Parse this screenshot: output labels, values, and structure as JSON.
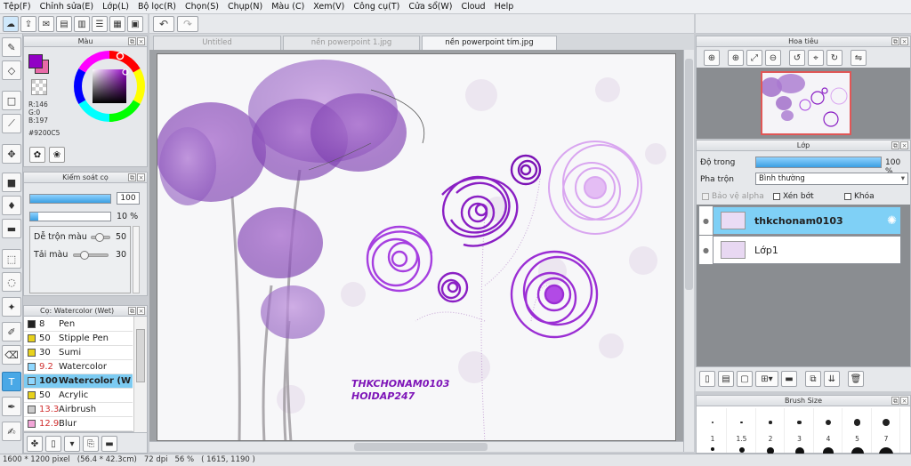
{
  "menu": [
    "Tệp(F)",
    "Chỉnh sửa(E)",
    "Lớp(L)",
    "Bộ lọc(R)",
    "Chọn(S)",
    "Chụp(N)",
    "Màu (C)",
    "Xem(V)",
    "Công cụ(T)",
    "Cửa sổ(W)",
    "Cloud",
    "Help"
  ],
  "color_panel": {
    "title": "Màu",
    "primary_color": "#9200C5",
    "secondary_color": "#E86AA8",
    "r": "R:146",
    "g": "G:0",
    "b": "B:197",
    "hex": "#9200C5"
  },
  "brush_control": {
    "title": "Kiểm soát cọ",
    "size_value": "100",
    "opacity_value": "10 %",
    "size_fraction": 1.0,
    "opacity_fraction": 0.1,
    "blend_label": "Dễ trộn màu",
    "blend_value": "50",
    "load_label": "Tải màu",
    "load_value": "30"
  },
  "brush_list": {
    "title": "Cọ: Watercolor (Wet)",
    "items": [
      {
        "size": "8",
        "name": "Pen",
        "color": "#222222",
        "red": false
      },
      {
        "size": "50",
        "name": "Stipple Pen",
        "color": "#e8d21c",
        "red": false
      },
      {
        "size": "30",
        "name": "Sumi",
        "color": "#e8d21c",
        "red": false
      },
      {
        "size": "9.2",
        "name": "Watercolor",
        "color": "#8fd8ff",
        "red": true
      },
      {
        "size": "100",
        "name": "Watercolor (W",
        "color": "#8fd8ff",
        "red": false
      },
      {
        "size": "50",
        "name": "Acrylic",
        "color": "#e8d21c",
        "red": false
      },
      {
        "size": "13.3",
        "name": "Airbrush",
        "color": "#cccccc",
        "red": true
      },
      {
        "size": "12.9",
        "name": "Blur",
        "color": "#f2a6d8",
        "red": true
      }
    ]
  },
  "tabs": [
    "Untitled",
    "nền powerpoint 1.jpg",
    "nền powerpoint tím.jpg"
  ],
  "canvas_text": {
    "line1": "THKCHONAM0103",
    "line2": "HOIDAP247"
  },
  "navigator": {
    "title": "Hoa tiêu"
  },
  "layers_panel": {
    "title": "Lớp",
    "opacity_label": "Độ trong",
    "opacity_value": "100 %",
    "opacity_fraction": 1.0,
    "blend_label": "Pha trộn",
    "blend_value": "Bình thường",
    "protect_alpha": "Bảo vệ alpha",
    "clipping": "Xén bớt",
    "lock": "Khóa",
    "layers": [
      {
        "name": "thkchonam0103",
        "selected": true
      },
      {
        "name": "Lớp1",
        "selected": false
      }
    ]
  },
  "brush_size": {
    "title": "Brush Size",
    "labels": [
      "1",
      "1.5",
      "2",
      "3",
      "4",
      "5",
      "7"
    ]
  },
  "status": {
    "dimensions": "1600 * 1200 pixel",
    "physical": "(56.4 * 42.3cm)",
    "dpi": "72 dpi",
    "zoom": "56 %",
    "cursor": "( 1615, 1190 )"
  }
}
